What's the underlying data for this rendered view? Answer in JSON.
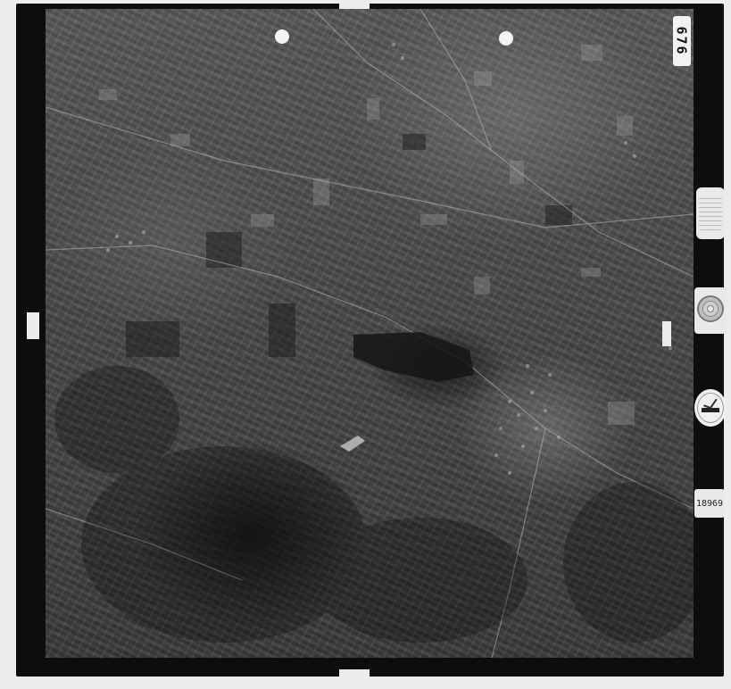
{
  "photo": {
    "frame_number": "676",
    "subject": "aerial-photograph"
  },
  "instruments": {
    "altimeter": "altimeter-icon",
    "level": "level-bubble-icon",
    "level_top_text": "",
    "level_bottom_text": "",
    "clock": "clock-icon",
    "label_card_line1": "18969",
    "label_card_line2": ""
  },
  "colors": {
    "frame": "#0d0d0d",
    "paper": "#ececec",
    "terrain_light": "#8a8a8a",
    "terrain_dark": "#222222",
    "lake": "#1a1a1a"
  }
}
